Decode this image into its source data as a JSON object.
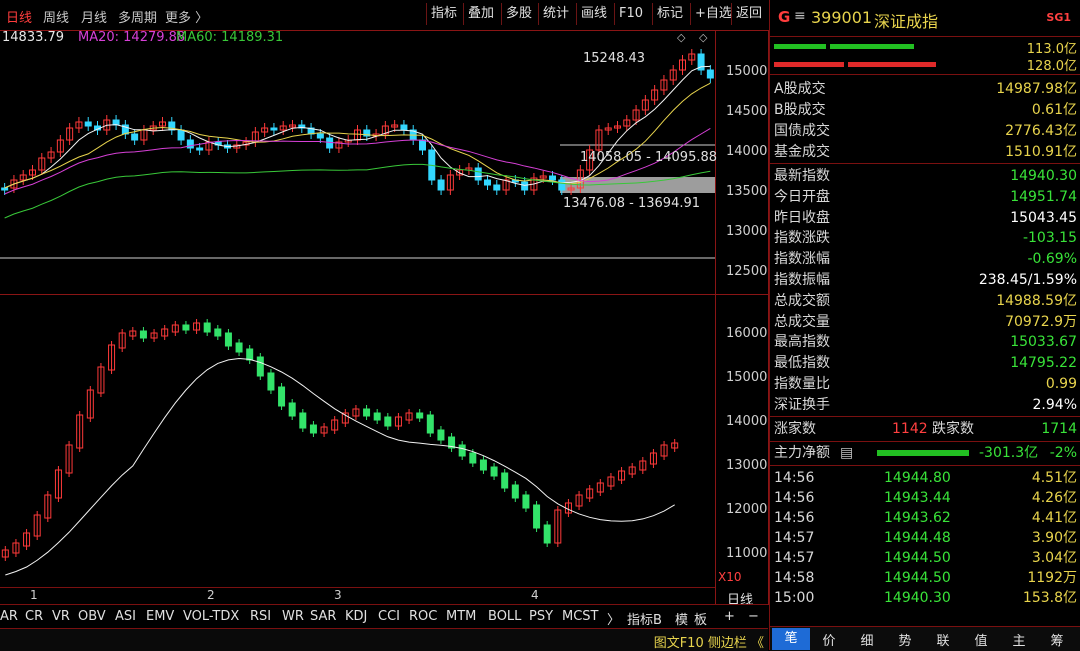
{
  "toolbar": {
    "periods": [
      "日线",
      "周线",
      "月线",
      "多周期",
      "更多 〉"
    ],
    "buttons": [
      "指标",
      "叠加",
      "多股",
      "统计",
      "画线",
      "F10",
      "标记",
      "+自选",
      "返回"
    ]
  },
  "legend": {
    "ma_prefix": "14833.79",
    "ma20_label": "MA20: 14279.88",
    "ma60_label": "MA60: 14189.31",
    "colors": {
      "ma_prefix": "#e8e8e8",
      "ma20": "#d640d6",
      "ma60": "#39c839"
    }
  },
  "price_pane": {
    "yticks": [
      "15000",
      "14500",
      "14000",
      "13500",
      "13000",
      "12500"
    ],
    "annotations": {
      "high": "15248.43",
      "range_upper": "14058.05 - 14095.88",
      "range_lower": "13476.08 - 13694.91"
    }
  },
  "volume_pane": {
    "yticks": [
      "16000",
      "15000",
      "14000",
      "13000",
      "12000",
      "11000"
    ],
    "unit": "X10",
    "period_label": "日线",
    "month_marks": [
      "1",
      "2",
      "3",
      "4"
    ]
  },
  "indicator_tabs": [
    "AR",
    "CR",
    "VR",
    "OBV",
    "ASI",
    "EMV",
    "VOL-TDX",
    "RSI",
    "WR",
    "SAR",
    "KDJ",
    "CCI",
    "ROC",
    "MTM",
    "BOLL",
    "PSY",
    "MCST",
    "〉",
    "指标B",
    "模",
    "板",
    "+",
    "−"
  ],
  "statusbar": {
    "text": "图文F10 侧边栏 《"
  },
  "quote": {
    "badge": "G",
    "menu_icon": "≡",
    "code": "399001",
    "name": "深证成指",
    "tag": "SG1",
    "bar_values": [
      "113.0亿",
      "128.0亿"
    ],
    "turnover": [
      {
        "k": "A股成交",
        "v": "14987.98亿"
      },
      {
        "k": "B股成交",
        "v": "0.61亿"
      },
      {
        "k": "国债成交",
        "v": "2776.43亿"
      },
      {
        "k": "基金成交",
        "v": "1510.91亿"
      }
    ],
    "stats": [
      {
        "k": "最新指数",
        "v": "14940.30",
        "c": "green"
      },
      {
        "k": "今日开盘",
        "v": "14951.74",
        "c": "green"
      },
      {
        "k": "昨日收盘",
        "v": "15043.45",
        "c": "white"
      },
      {
        "k": "指数涨跌",
        "v": "-103.15",
        "c": "green"
      },
      {
        "k": "指数涨幅",
        "v": "-0.69%",
        "c": "green"
      },
      {
        "k": "指数振幅",
        "v": "238.45/1.59%",
        "c": "white"
      },
      {
        "k": "总成交额",
        "v": "14988.59亿",
        "c": "yellow"
      },
      {
        "k": "总成交量",
        "v": "70972.9万",
        "c": "yellow"
      },
      {
        "k": "最高指数",
        "v": "15033.67",
        "c": "green"
      },
      {
        "k": "最低指数",
        "v": "14795.22",
        "c": "green"
      },
      {
        "k": "指数量比",
        "v": "0.99",
        "c": "yellow"
      },
      {
        "k": "深证换手",
        "v": "2.94%",
        "c": "white"
      }
    ],
    "adv_label": "涨家数",
    "adv_value": "1142",
    "dec_label": "跌家数",
    "dec_value": "1714",
    "flow_label": "主力净额",
    "flow_icon": "▤",
    "flow_value": "-301.3亿",
    "flow_pct": "-2%",
    "ticks": [
      {
        "t": "14:56",
        "p": "14944.80",
        "v": "4.51亿"
      },
      {
        "t": "14:56",
        "p": "14943.44",
        "v": "4.26亿"
      },
      {
        "t": "14:56",
        "p": "14943.62",
        "v": "4.41亿"
      },
      {
        "t": "14:57",
        "p": "14944.48",
        "v": "3.90亿"
      },
      {
        "t": "14:57",
        "p": "14944.50",
        "v": "3.04亿"
      },
      {
        "t": "14:58",
        "p": "14944.50",
        "v": "1192万"
      },
      {
        "t": "15:00",
        "p": "14940.30",
        "v": "153.8亿"
      }
    ],
    "tabs": [
      "笔",
      "价",
      "细",
      "势",
      "联",
      "值",
      "主",
      "筹"
    ]
  }
}
